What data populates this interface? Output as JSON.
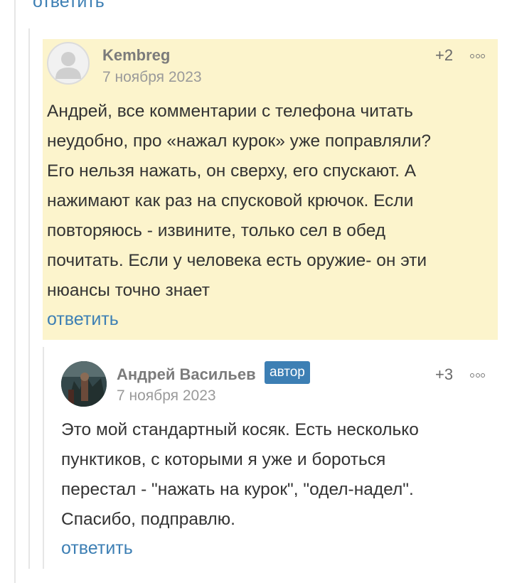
{
  "top_reply_label": "ответить",
  "comments": [
    {
      "author": "Kembreg",
      "date": "7 ноября 2023",
      "rating": "+2",
      "more_icon": "more-dots-icon",
      "avatar": "default-user-avatar",
      "text_lines": [
        "Андрей, все комментарии с телефона читать",
        "неудобно, про «нажал курок» уже поправляли?",
        "Его нельзя нажать, он сверху, его спускают. А",
        "нажимают как раз на спусковой крючок. Если",
        "повторяюсь - извините, только сел в обед",
        "почитать. Если у человека есть оружие- он эти",
        "нюансы точно знает"
      ],
      "reply_label": "ответить",
      "highlight_color": "#fcf4cc"
    },
    {
      "author": "Андрей Васильев",
      "badge": "автор",
      "date": "7 ноября 2023",
      "rating": "+3",
      "more_icon": "more-dots-icon",
      "avatar": "user-photo-avatar",
      "text_lines": [
        "Это мой стандартный косяк. Есть несколько",
        "пунктиков, с которыми я уже и бороться",
        "перестал - \"нажать на курок\", \"одел-надел\".",
        "Спасибо, подправлю."
      ],
      "reply_label": "ответить"
    }
  ],
  "colors": {
    "link": "#3d7fb4",
    "badge_bg": "#3d7fb4",
    "author": "#7b7b7b",
    "date": "#9a9a9a",
    "text": "#333333",
    "thread_line": "#e6e6e6"
  }
}
